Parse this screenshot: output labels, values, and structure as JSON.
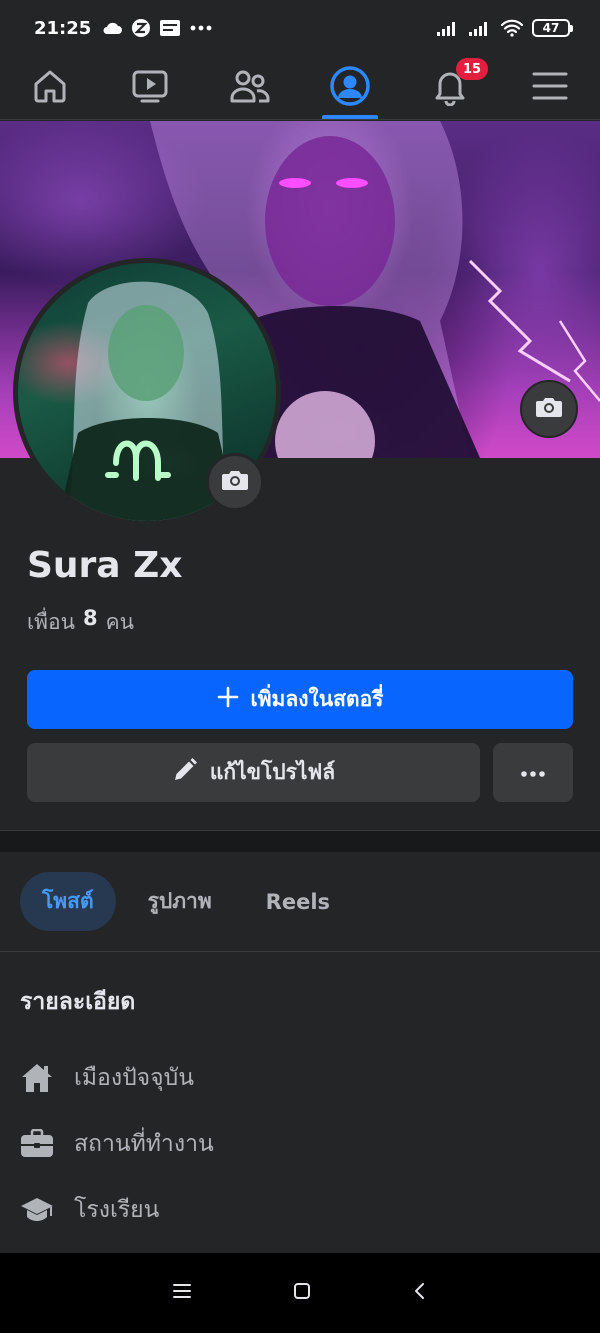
{
  "status_bar": {
    "time": "21:25",
    "battery": "47",
    "left_icons": [
      "cloud-icon",
      "z-app-icon",
      "webtoon-icon",
      "more-dots-icon"
    ],
    "right_icons": [
      "signal-icon",
      "signal-icon",
      "wifi-icon",
      "battery-icon"
    ]
  },
  "nav": {
    "items": [
      {
        "icon": "home-icon"
      },
      {
        "icon": "video-icon"
      },
      {
        "icon": "friends-icon"
      },
      {
        "icon": "profile-icon",
        "active": true
      },
      {
        "icon": "bell-icon",
        "badge": "15"
      },
      {
        "icon": "menu-icon"
      }
    ],
    "notifications_badge": "15"
  },
  "profile": {
    "name": "Sura Zx",
    "friends_prefix": "เพื่อน",
    "friends_count": "8",
    "friends_suffix": "คน"
  },
  "actions": {
    "add_story_label": "เพิ่มลงในสตอรี่",
    "edit_profile_label": "แก้ไขโปรไฟล์"
  },
  "tabs": [
    {
      "label": "โพสต์",
      "active": true
    },
    {
      "label": "รูปภาพ"
    },
    {
      "label": "Reels"
    }
  ],
  "details": {
    "title": "รายละเอียด",
    "items": [
      {
        "icon": "home-icon",
        "label": "เมืองปัจจุบัน"
      },
      {
        "icon": "briefcase-icon",
        "label": "สถานที่ทำงาน"
      },
      {
        "icon": "graduation-cap-icon",
        "label": "โรงเรียน"
      }
    ]
  },
  "colors": {
    "background": "#242526",
    "accent": "#0866ff",
    "active_tab": "#2d88ff",
    "badge": "#e41e3f"
  }
}
